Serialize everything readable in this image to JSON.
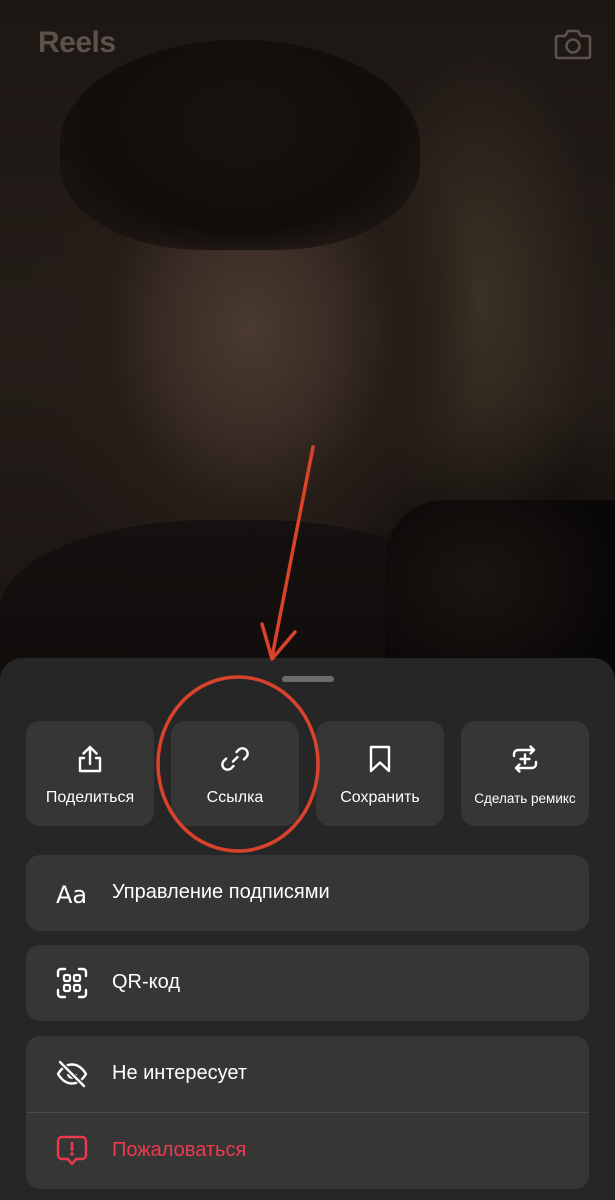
{
  "header": {
    "title": "Reels",
    "camera_icon": "camera-icon"
  },
  "sheet": {
    "actions": [
      {
        "label": "Поделиться",
        "icon": "share-icon"
      },
      {
        "label": "Ссылка",
        "icon": "link-icon"
      },
      {
        "label": "Сохранить",
        "icon": "bookmark-icon"
      },
      {
        "label": "Сделать ремикс",
        "icon": "remix-icon"
      }
    ],
    "rows": {
      "captions": {
        "label": "Управление подписями",
        "icon": "captions-icon"
      },
      "qr": {
        "label": "QR-код",
        "icon": "qr-code-icon"
      },
      "not_interested": {
        "label": "Не интересует",
        "icon": "eye-slash-icon"
      },
      "report": {
        "label": "Пожаловаться",
        "icon": "report-icon"
      }
    }
  },
  "colors": {
    "sheet_bg": "#262626",
    "tile_bg": "#363636",
    "danger": "#ef3a4e",
    "annotation": "#d9432b"
  }
}
